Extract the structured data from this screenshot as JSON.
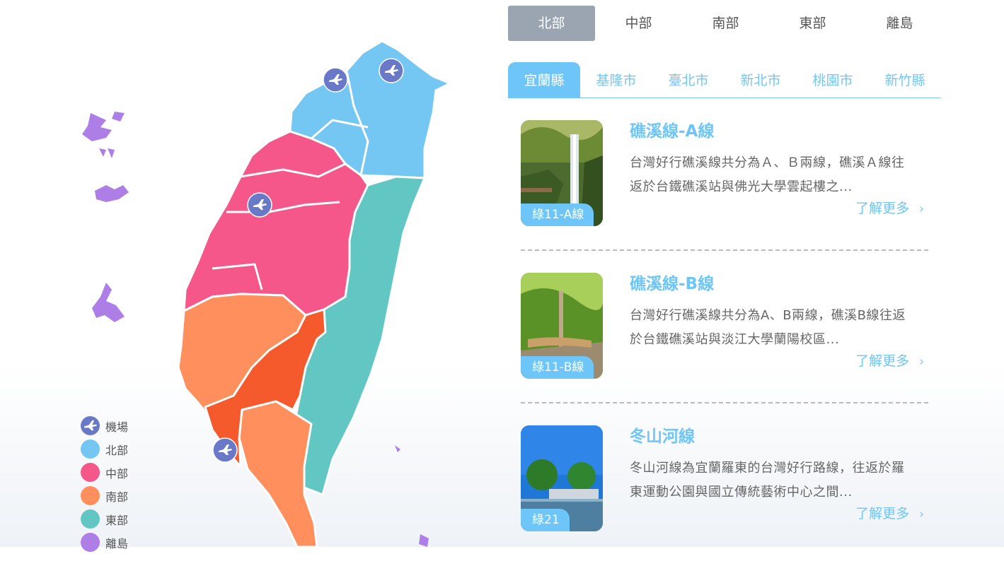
{
  "legend": [
    {
      "label": "機場",
      "color": "#6a78c8",
      "icon": "airplane-icon"
    },
    {
      "label": "北部",
      "color": "#74c6f3"
    },
    {
      "label": "中部",
      "color": "#f5578a"
    },
    {
      "label": "南部",
      "color": "#ff8f5d"
    },
    {
      "label": "東部",
      "color": "#62c6c2"
    },
    {
      "label": "離島",
      "color": "#ad7ee6"
    }
  ],
  "region_tabs": [
    {
      "label": "北部",
      "active": true
    },
    {
      "label": "中部"
    },
    {
      "label": "南部"
    },
    {
      "label": "東部"
    },
    {
      "label": "離島"
    }
  ],
  "county_tabs": [
    {
      "label": "宜蘭縣",
      "active": true
    },
    {
      "label": "基隆市"
    },
    {
      "label": "臺北市"
    },
    {
      "label": "新北市"
    },
    {
      "label": "桃園市"
    },
    {
      "label": "新竹縣"
    }
  ],
  "routes": [
    {
      "title": "礁溪線-A線",
      "badge": "綠11-A線",
      "desc_line1": "台灣好行礁溪線共分為Ａ、Ｂ兩線，礁溪Ａ線往",
      "desc_line2": "返於台鐵礁溪站與佛光大學雲起樓之...",
      "more": "了解更多"
    },
    {
      "title": "礁溪線-B線",
      "badge": "綠11-B線",
      "desc_line1": "台灣好行礁溪線共分為A、B兩線，礁溪B線往返",
      "desc_line2": "於台鐵礁溪站與淡江大學蘭陽校區...",
      "more": "了解更多"
    },
    {
      "title": "冬山河線",
      "badge": "綠21",
      "desc_line1": "冬山河線為宜蘭羅東的台灣好行路線，往返於羅",
      "desc_line2": "東運動公園與國立傳統藝術中心之間...",
      "more": "了解更多"
    }
  ],
  "colors": {
    "north": "#74c6f3",
    "central": "#f5578a",
    "south": "#ff8f5d",
    "south_dark": "#f55a2c",
    "east": "#62c6c2",
    "islands": "#ad7ee6",
    "airport": "#6a78c8",
    "region_tab_active": "#9aa5b1"
  }
}
